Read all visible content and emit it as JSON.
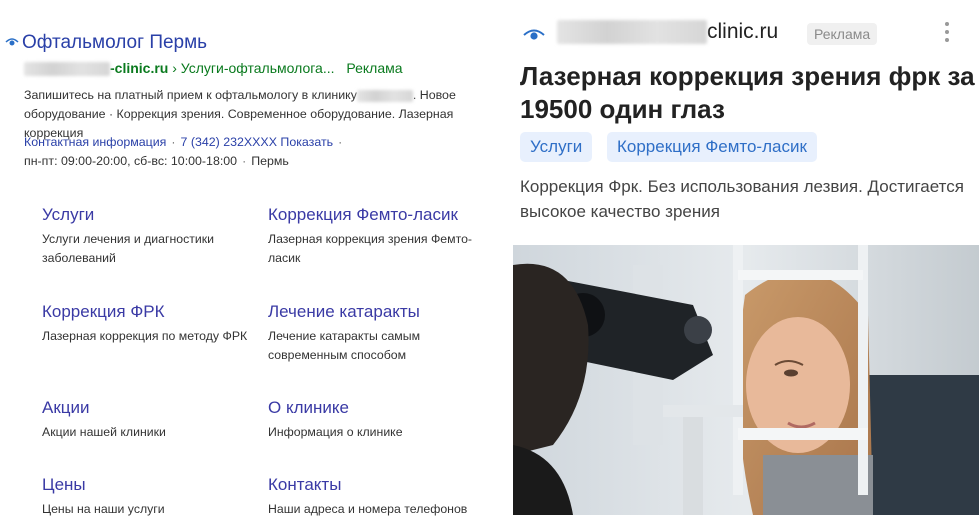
{
  "left_ad": {
    "title": "Офтальмолог Пермь",
    "url_suffix": "-clinic.ru",
    "breadcrumb": "› Услуги-офтальмолога...",
    "ad_label": "Реклама",
    "desc_part1": "Запишитесь на платный прием к офтальмологу в клинику",
    "desc_part2": ". Новое оборудование · Коррекция зрения. Современное оборудование. Лазерная коррекция",
    "contact_link": "Контактная информация",
    "phone": "7 (342) 232XXXX",
    "phone_show": "Показать",
    "hours": "пн-пт: 09:00-20:00, сб-вс: 10:00-18:00",
    "city": "Пермь",
    "sitelinks": [
      {
        "title": "Услуги",
        "desc": "Услуги лечения и диагностики заболеваний"
      },
      {
        "title": "Коррекция Фемто-ласик",
        "desc": "Лазерная коррекция зрения Фемто-ласик"
      },
      {
        "title": "Коррекция ФРК",
        "desc": "Лазерная коррекция по методу ФРК"
      },
      {
        "title": "Лечение катаракты",
        "desc": "Лечение катаракты самым современным способом"
      },
      {
        "title": "Акции",
        "desc": "Акции нашей клиники"
      },
      {
        "title": "О клинике",
        "desc": "Информация о клинике"
      },
      {
        "title": "Цены",
        "desc": "Цены на наши услуги"
      },
      {
        "title": "Контакты",
        "desc": "Наши адреса и номера телефонов"
      }
    ]
  },
  "right_ad": {
    "domain_suffix": "clinic.ru",
    "ad_label": "Реклама",
    "title": "Лазерная коррекция зрения фрк за 19500 один глаз",
    "chips": [
      "Услуги",
      "Коррекция Фемто-ласик"
    ],
    "desc": "Коррекция Фрк. Без использования лезвия. Достигается высокое качество зрения"
  },
  "icons": {
    "eye": "eye-icon",
    "menu": "kebab-menu-icon",
    "photo": "eye-exam-photo"
  },
  "colors": {
    "link_blue": "#2a40a8",
    "url_green": "#0a7a1e",
    "chip_bg": "#e8f0fd",
    "chip_text": "#2f6fc7"
  }
}
